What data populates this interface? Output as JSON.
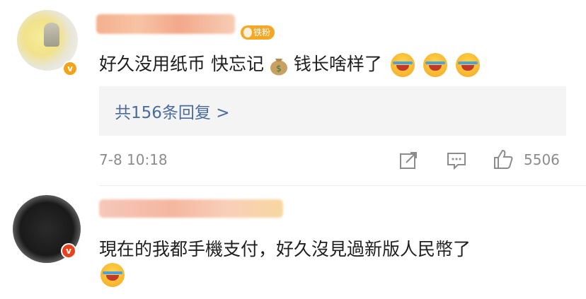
{
  "comments": [
    {
      "fan_badge": "铁粉",
      "text": "好久没用纸币 快忘记",
      "text_after": "钱长啥样了",
      "emoji_icon": "money-bag",
      "trailing_emojis": [
        "laugh-cry",
        "laugh-cry",
        "laugh-cry"
      ],
      "replies_label": "共156条回复 >",
      "timestamp": "7-8 10:18",
      "like_count": "5506"
    },
    {
      "text": "現在的我都手機支付，好久沒見過新版人民幣了",
      "trailing_emojis": [
        "laugh"
      ]
    }
  ],
  "colors": {
    "reply_link": "#4a6b9c",
    "meta_text": "#8c8c8c",
    "fan_badge": "#f5a623",
    "reply_bg": "#f4f4f5"
  }
}
